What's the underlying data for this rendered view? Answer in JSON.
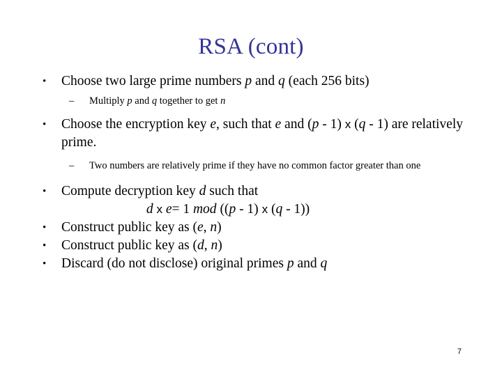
{
  "slide": {
    "title": "RSA (cont)",
    "title_color": "#333399",
    "background_color": "#ffffff",
    "text_color": "#000000",
    "page_number": "7"
  },
  "content": [
    {
      "level": "bullet",
      "marker": "•",
      "plain_text": "Choose two large prime numbers p and q (each 256 bits)",
      "parts": [
        {
          "t": "Choose two large prime numbers ",
          "style": "roman"
        },
        {
          "t": "p",
          "style": "italic"
        },
        {
          "t": " and ",
          "style": "roman"
        },
        {
          "t": "q",
          "style": "italic"
        },
        {
          "t": " (each 256 bits)",
          "style": "roman"
        }
      ]
    },
    {
      "level": "sub",
      "marker": "–",
      "plain_text": "Multiply p and q together to get n",
      "parts": [
        {
          "t": "Multiply ",
          "style": "roman"
        },
        {
          "t": "p",
          "style": "italic"
        },
        {
          "t": " and ",
          "style": "roman"
        },
        {
          "t": "q",
          "style": "italic"
        },
        {
          "t": " together to get ",
          "style": "roman"
        },
        {
          "t": "n",
          "style": "italic"
        }
      ]
    },
    {
      "level": "bullet",
      "marker": "•",
      "plain_text": "Choose the encryption key e, such that e and (p - 1) x (q - 1) are relatively prime.",
      "parts": [
        {
          "t": "Choose the encryption key ",
          "style": "roman"
        },
        {
          "t": "e",
          "style": "italic"
        },
        {
          "t": ", such that ",
          "style": "roman"
        },
        {
          "t": "e",
          "style": "italic"
        },
        {
          "t": " and (",
          "style": "roman"
        },
        {
          "t": "p",
          "style": "italic"
        },
        {
          "t": " - 1) ",
          "style": "roman"
        },
        {
          "t": "x",
          "style": "multiply"
        },
        {
          "t": " (",
          "style": "roman"
        },
        {
          "t": "q",
          "style": "italic"
        },
        {
          "t": " - 1) are relatively prime.",
          "style": "roman"
        }
      ]
    },
    {
      "level": "sub",
      "marker": "–",
      "plain_text": "Two numbers are relatively prime if they have no common factor greater than one",
      "parts": [
        {
          "t": "Two numbers are relatively prime if they have no common factor greater than one",
          "style": "roman"
        }
      ]
    },
    {
      "level": "bullet",
      "marker": "•",
      "plain_text": "Compute decryption key d such that",
      "parts": [
        {
          "t": "Compute decryption key ",
          "style": "roman"
        },
        {
          "t": "d",
          "style": "italic"
        },
        {
          "t": " such that",
          "style": "roman"
        }
      ]
    },
    {
      "level": "equation",
      "marker": "",
      "plain_text": "d x e= 1 mod ((p - 1) x (q - 1))",
      "parts": [
        {
          "t": "d",
          "style": "italic"
        },
        {
          "t": " ",
          "style": "roman"
        },
        {
          "t": "x",
          "style": "multiply"
        },
        {
          "t": " ",
          "style": "roman"
        },
        {
          "t": "e",
          "style": "italic"
        },
        {
          "t": "= 1 ",
          "style": "roman"
        },
        {
          "t": "mod",
          "style": "italic"
        },
        {
          "t": " ((",
          "style": "roman"
        },
        {
          "t": "p",
          "style": "italic"
        },
        {
          "t": " - 1) ",
          "style": "roman"
        },
        {
          "t": "x",
          "style": "multiply"
        },
        {
          "t": " (",
          "style": "roman"
        },
        {
          "t": "q",
          "style": "italic"
        },
        {
          "t": " - 1))",
          "style": "roman"
        }
      ]
    },
    {
      "level": "bullet",
      "marker": "•",
      "plain_text": "Construct public key as (e, n)",
      "parts": [
        {
          "t": "Construct public key as (",
          "style": "roman"
        },
        {
          "t": "e",
          "style": "italic"
        },
        {
          "t": ", ",
          "style": "roman"
        },
        {
          "t": "n",
          "style": "italic"
        },
        {
          "t": ")",
          "style": "roman"
        }
      ]
    },
    {
      "level": "bullet",
      "marker": "•",
      "plain_text": "Construct public key as (d, n)",
      "parts": [
        {
          "t": "Construct public key as (",
          "style": "roman"
        },
        {
          "t": "d",
          "style": "italic"
        },
        {
          "t": ", ",
          "style": "roman"
        },
        {
          "t": "n",
          "style": "italic"
        },
        {
          "t": ")",
          "style": "roman"
        }
      ]
    },
    {
      "level": "bullet",
      "marker": "•",
      "plain_text": "Discard (do not disclose) original primes p  and q",
      "parts": [
        {
          "t": "Discard (do not disclose) original primes ",
          "style": "roman"
        },
        {
          "t": "p",
          "style": "italic"
        },
        {
          "t": "  and ",
          "style": "roman"
        },
        {
          "t": "q",
          "style": "italic"
        }
      ]
    }
  ]
}
